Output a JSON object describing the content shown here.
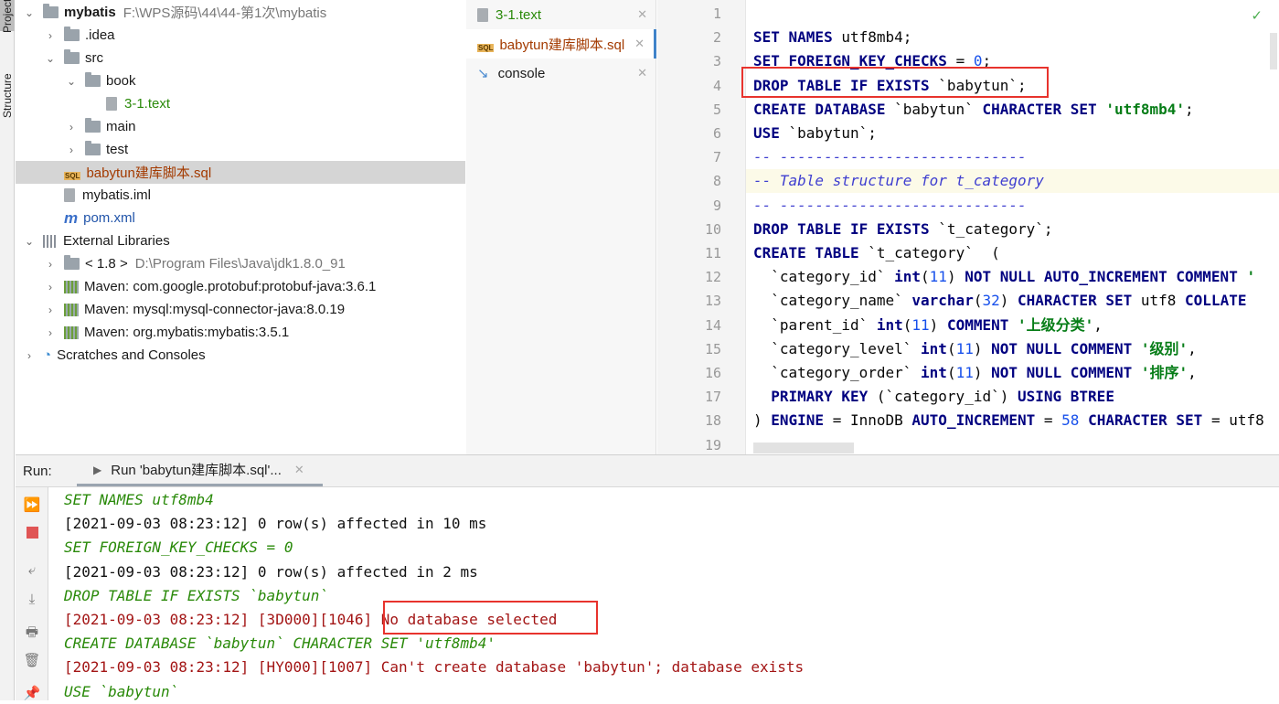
{
  "sidebar_tabs": [
    "Project",
    "Structure"
  ],
  "tree": [
    {
      "label": "mybatis",
      "path": "F:\\WPS源码\\44\\44-第1次\\mybatis",
      "icon": "module-icon",
      "chevron": "down",
      "indent": 0,
      "bold": true
    },
    {
      "label": ".idea",
      "icon": "folder-icon",
      "chevron": "right",
      "indent": 1
    },
    {
      "label": "src",
      "icon": "folder-icon",
      "chevron": "down",
      "indent": 1
    },
    {
      "label": "book",
      "icon": "folder-icon",
      "chevron": "down",
      "indent": 2
    },
    {
      "label": "3-1.text",
      "icon": "text-file-icon",
      "chevron": "",
      "indent": 3,
      "color": "#2a8a0a"
    },
    {
      "label": "main",
      "icon": "folder-icon",
      "chevron": "right",
      "indent": 2
    },
    {
      "label": "test",
      "icon": "folder-icon",
      "chevron": "right",
      "indent": 2
    },
    {
      "label": "babytun建库脚本.sql",
      "icon": "sql-file-icon",
      "chevron": "",
      "indent": 1,
      "color": "#a33a00",
      "selected": true
    },
    {
      "label": "mybatis.iml",
      "icon": "iml-file-icon",
      "chevron": "",
      "indent": 1
    },
    {
      "label": "pom.xml",
      "icon": "maven-file-icon",
      "chevron": "",
      "indent": 1,
      "color": "#2255aa"
    },
    {
      "label": "External Libraries",
      "icon": "library-icon",
      "chevron": "down",
      "indent": 0
    },
    {
      "label": "< 1.8 >",
      "path": "D:\\Program Files\\Java\\jdk1.8.0_91",
      "icon": "jdk-icon",
      "chevron": "right",
      "indent": 1
    },
    {
      "label": "Maven: com.google.protobuf:protobuf-java:3.6.1",
      "icon": "maven-lib-icon",
      "chevron": "right",
      "indent": 1
    },
    {
      "label": "Maven: mysql:mysql-connector-java:8.0.19",
      "icon": "maven-lib-icon",
      "chevron": "right",
      "indent": 1
    },
    {
      "label": "Maven: org.mybatis:mybatis:3.5.1",
      "icon": "maven-lib-icon",
      "chevron": "right",
      "indent": 1
    },
    {
      "label": "Scratches and Consoles",
      "icon": "scratches-icon",
      "chevron": "right",
      "indent": 0
    }
  ],
  "editor_tabs": [
    {
      "label": "3-1.text",
      "color": "#2a8a0a",
      "icon": "text-file-icon"
    },
    {
      "label": "babytun建库脚本.sql",
      "color": "#a33a00",
      "icon": "sql-file-icon",
      "active": true
    },
    {
      "label": "console",
      "color": "#1a1a1a",
      "icon": "console-icon"
    }
  ],
  "code": [
    [],
    [
      [
        "kw",
        "SET NAMES "
      ],
      [
        "",
        "utf8mb4;"
      ]
    ],
    [
      [
        "kw",
        "SET FOREIGN_KEY_CHECKS "
      ],
      [
        "",
        "= "
      ],
      [
        "num",
        "0"
      ],
      [
        "",
        ";"
      ]
    ],
    [
      [
        "kw",
        "DROP TABLE IF EXISTS "
      ],
      [
        "",
        "`babytun`;"
      ]
    ],
    [
      [
        "kw",
        "CREATE DATABASE "
      ],
      [
        "",
        "`babytun` "
      ],
      [
        "kw",
        "CHARACTER SET "
      ],
      [
        "str",
        "'utf8mb4'"
      ],
      [
        "",
        ";"
      ]
    ],
    [
      [
        "kw",
        "USE "
      ],
      [
        "",
        "`babytun`;"
      ]
    ],
    [
      [
        "cm",
        "-- ----------------------------"
      ]
    ],
    [
      [
        "cm",
        "-- Table structure for t_category"
      ]
    ],
    [
      [
        "cm",
        "-- ----------------------------"
      ]
    ],
    [
      [
        "kw",
        "DROP TABLE IF EXISTS "
      ],
      [
        "",
        "`t_category`;"
      ]
    ],
    [
      [
        "kw",
        "CREATE TABLE "
      ],
      [
        "",
        "`t_category`  ("
      ]
    ],
    [
      [
        "",
        "  `category_id` "
      ],
      [
        "kw",
        "int"
      ],
      [
        "",
        "("
      ],
      [
        "num",
        "11"
      ],
      [
        "",
        ") "
      ],
      [
        "kw",
        "NOT NULL AUTO_INCREMENT COMMENT "
      ],
      [
        "str",
        "'"
      ]
    ],
    [
      [
        "",
        "  `category_name` "
      ],
      [
        "kw",
        "varchar"
      ],
      [
        "",
        "("
      ],
      [
        "num",
        "32"
      ],
      [
        "",
        ") "
      ],
      [
        "kw",
        "CHARACTER SET "
      ],
      [
        "",
        "utf8 "
      ],
      [
        "kw",
        "COLLATE"
      ]
    ],
    [
      [
        "",
        "  `parent_id` "
      ],
      [
        "kw",
        "int"
      ],
      [
        "",
        "("
      ],
      [
        "num",
        "11"
      ],
      [
        "",
        ") "
      ],
      [
        "kw",
        "COMMENT "
      ],
      [
        "str",
        "'上级分类'"
      ],
      [
        "",
        ","
      ]
    ],
    [
      [
        "",
        "  `category_level` "
      ],
      [
        "kw",
        "int"
      ],
      [
        "",
        "("
      ],
      [
        "num",
        "11"
      ],
      [
        "",
        ") "
      ],
      [
        "kw",
        "NOT NULL COMMENT "
      ],
      [
        "str",
        "'级别'"
      ],
      [
        "",
        ","
      ]
    ],
    [
      [
        "",
        "  `category_order` "
      ],
      [
        "kw",
        "int"
      ],
      [
        "",
        "("
      ],
      [
        "num",
        "11"
      ],
      [
        "",
        ") "
      ],
      [
        "kw",
        "NOT NULL COMMENT "
      ],
      [
        "str",
        "'排序'"
      ],
      [
        "",
        ","
      ]
    ],
    [
      [
        "kw",
        "  PRIMARY KEY "
      ],
      [
        "",
        "(`category_id`) "
      ],
      [
        "kw",
        "USING BTREE"
      ]
    ],
    [
      [
        "",
        ") "
      ],
      [
        "kw",
        "ENGINE "
      ],
      [
        "",
        "= InnoDB "
      ],
      [
        "kw",
        "AUTO_INCREMENT "
      ],
      [
        "",
        "= "
      ],
      [
        "num",
        "58"
      ],
      [
        "kw",
        " CHARACTER SET "
      ],
      [
        "",
        "= utf8"
      ]
    ],
    []
  ],
  "highlighted_line": 8,
  "run": {
    "label": "Run:",
    "tab": "Run 'babytun建库脚本.sql'..."
  },
  "console": [
    [
      "cq",
      "SET NAMES utf8mb4"
    ],
    [
      "cok",
      "[2021-09-03 08:23:12] 0 row(s) affected in 10 ms"
    ],
    [
      "cq",
      "SET FOREIGN_KEY_CHECKS = 0"
    ],
    [
      "cok",
      "[2021-09-03 08:23:12] 0 row(s) affected in 2 ms"
    ],
    [
      "cq",
      "DROP TABLE IF EXISTS `babytun`"
    ],
    [
      "cerr",
      "[2021-09-03 08:23:12] [3D000][1046] No database selected"
    ],
    [
      "cq",
      "CREATE DATABASE `babytun` CHARACTER SET 'utf8mb4'"
    ],
    [
      "cerr",
      "[2021-09-03 08:23:12] [HY000][1007] Can't create database 'babytun'; database exists"
    ],
    [
      "cq",
      "USE `babytun`"
    ]
  ]
}
